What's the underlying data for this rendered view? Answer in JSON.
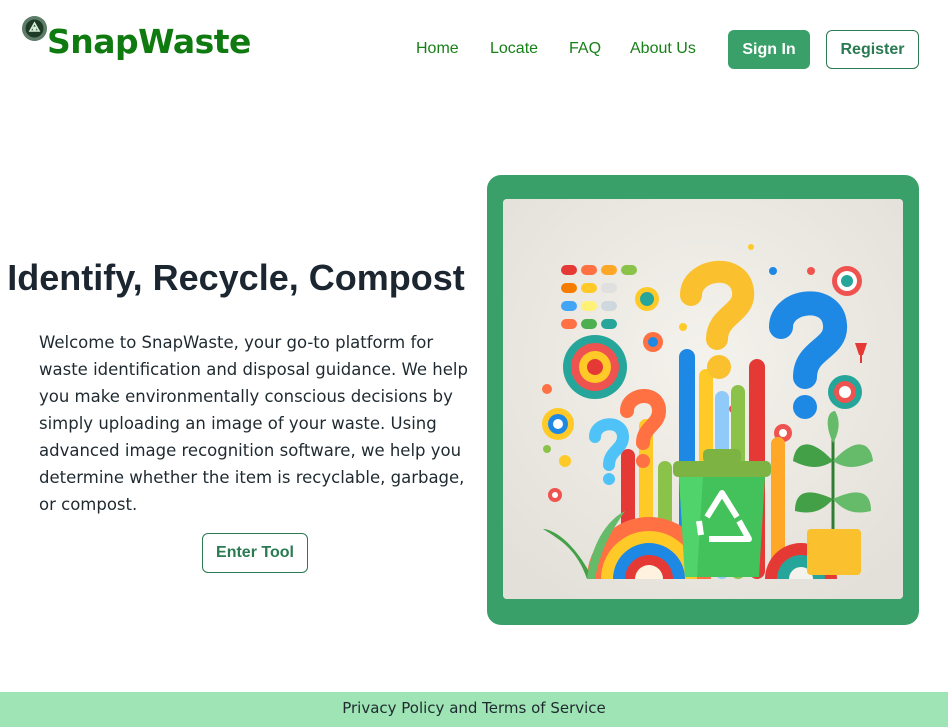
{
  "brand": {
    "name": "SnapWaste",
    "color": "#0f7a0f"
  },
  "nav": {
    "links": [
      {
        "label": "Home"
      },
      {
        "label": "Locate"
      },
      {
        "label": "FAQ"
      },
      {
        "label": "About Us"
      }
    ],
    "sign_in_label": "Sign In",
    "register_label": "Register"
  },
  "hero": {
    "title": "Identify, Recycle, Compost",
    "body": "Welcome to SnapWaste, your go-to platform for waste identification and disposal guidance. We help you make environmentally conscious decisions by simply uploading an image of your waste. Using advanced image recognition software, we help you determine whether the item is recyclable, garbage, or compost.",
    "cta_label": "Enter Tool"
  },
  "illustration": {
    "icon": "recycling-bin-with-question-marks-illustration"
  },
  "footer": {
    "link_label": "Privacy Policy and Terms of Service"
  },
  "colors": {
    "accent": "#3aa06a",
    "nav_link": "#188018",
    "footer_bg": "#9ee4b4"
  }
}
